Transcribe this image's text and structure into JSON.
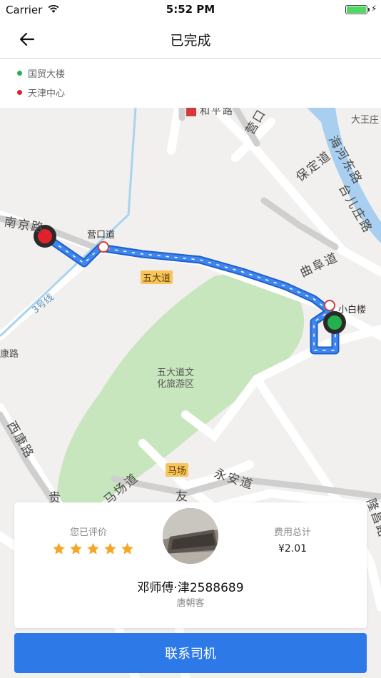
{
  "status_bar": {
    "carrier": "Carrier",
    "time": "5:52 PM",
    "charging_symbol": "⚡"
  },
  "nav": {
    "title": "已完成",
    "back_icon": "arrow-left-icon"
  },
  "route": {
    "start": "国贸大楼",
    "end": "天津中心",
    "start_color": "#22b14c",
    "end_color": "#e1202c"
  },
  "map": {
    "labels": {
      "heping_road": "和平路",
      "yingkou_top": "营口",
      "dawang_zhuang": "大王庄",
      "haihe_east": "海河东路",
      "baoding_road": "保定道",
      "taierzhuang": "台儿庄路",
      "nanjing_road": "南京路",
      "yingkou_station": "营口道",
      "wudadao_tag": "五大道",
      "qufu_road": "曲阜道",
      "xiaobailou": "小白楼",
      "line3": "3号线",
      "kang_road": "康路",
      "park_line1": "五大道文",
      "park_line2": "化旅游区",
      "xikang_road": "西康路",
      "machang_tag": "马场",
      "machang_road": "马场道",
      "yongan_road": "永安道",
      "gui": "贵",
      "you": "友",
      "longchang_road": "隆昌路"
    },
    "route_color": "#3b7ae0"
  },
  "driver_card": {
    "rating_caption": "您已评价",
    "rating": 5,
    "star_color": "#f5a623",
    "fee_caption": "费用总计",
    "fee_value": "¥2.01",
    "driver_name": "邓师傅·津2588689",
    "company": "唐朝客"
  },
  "contact_button": {
    "label": "联系司机",
    "color": "#2d79e8"
  }
}
